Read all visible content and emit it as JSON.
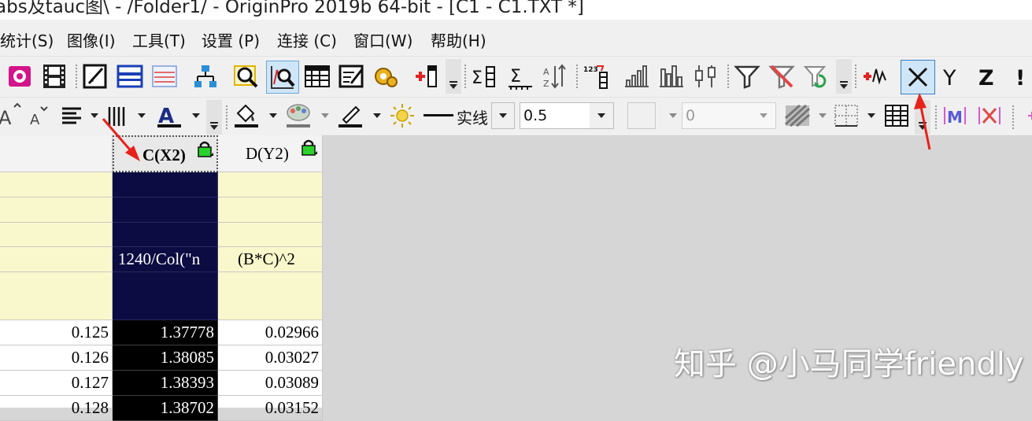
{
  "window": {
    "title": "abs及tauc图\\ - /Folder1/ - OriginPro 2019b 64-bit - [C1 - C1.TXT *]"
  },
  "menu": [
    "统计(S)",
    "图像(I)",
    "工具(T)",
    "设置 (P)",
    "连接 (C)",
    "窗口(W)",
    "帮助(H)"
  ],
  "toolbar1": {
    "icons": [
      "record-icon",
      "film-icon",
      "notes-icon",
      "horizontal-lines-icon",
      "layers-icon",
      "tree-icon",
      "zoom-icon",
      "zoom-data-icon",
      "worksheet-icon",
      "edit-sheet-icon",
      "gear-icon",
      "add-column-icon",
      "sigma-sum-icon",
      "sigma-stats-icon",
      "sort-icon",
      "number-set-icon",
      "bar-chart-icon",
      "histogram-icon",
      "box-chart-icon",
      "filter-icon",
      "clear-filter-icon",
      "reapply-filter-icon",
      "add-plot-icon",
      "set-as-x-icon",
      "set-as-y-icon",
      "set-as-z-icon",
      "set-as-error-icon"
    ],
    "xyz_labels": [
      "Y",
      "Z",
      "!"
    ]
  },
  "toolbar2": {
    "icons": [
      "increase-font-icon",
      "decrease-font-icon",
      "align-icon",
      "column-width-icon",
      "font-color-icon",
      "fill-color-icon",
      "pattern-color-icon",
      "line-color-icon",
      "brightness-icon",
      "line-style-icon",
      "swatch-icon",
      "hatch-icon",
      "border-icon",
      "table-icon",
      "merge-icon",
      "unmerge-icon"
    ],
    "line_style_label": "实线",
    "line_width_value": "0.5",
    "disabled_value": "0"
  },
  "sheet": {
    "columns": [
      {
        "header": "",
        "formula": ""
      },
      {
        "header": "C(X2)",
        "formula": "1240/Col(\"n"
      },
      {
        "header": "D(Y2)",
        "formula": "(B*C)^2"
      }
    ],
    "rows": [
      [
        "0.125",
        "1.37778",
        "0.02966"
      ],
      [
        "0.126",
        "1.38085",
        "0.03027"
      ],
      [
        "0.127",
        "1.38393",
        "0.03089"
      ],
      [
        "0.128",
        "1.38702",
        "0.03152"
      ]
    ]
  },
  "watermark": "知乎 @小马同学friendly",
  "colors": {
    "selection": "#0c0b42",
    "metadata_row": "#f9f8cc",
    "annotation_arrow": "#e8211b",
    "background": "#d6d6d6"
  }
}
